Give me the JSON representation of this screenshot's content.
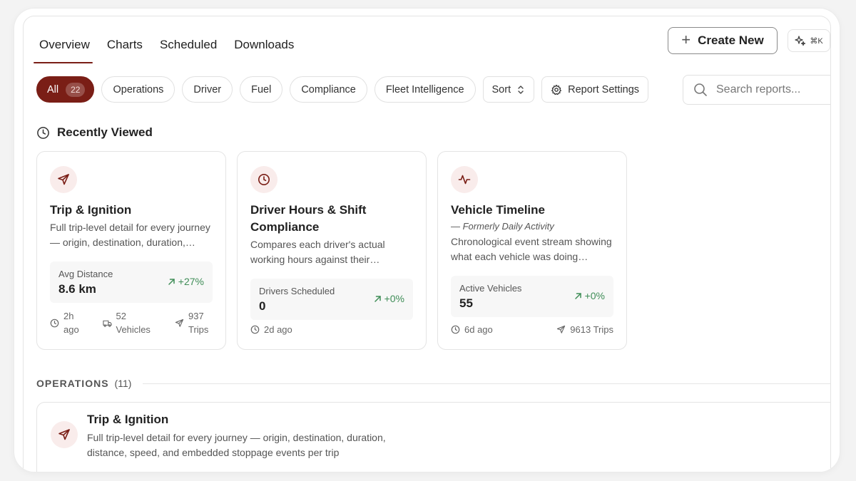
{
  "tabs": [
    {
      "label": "Overview",
      "active": true
    },
    {
      "label": "Charts"
    },
    {
      "label": "Scheduled"
    },
    {
      "label": "Downloads"
    }
  ],
  "header": {
    "create_label": "Create New",
    "shortcut_label": "⌘K"
  },
  "filters": {
    "all_label": "All",
    "all_count": "22",
    "chips": [
      "Operations",
      "Driver",
      "Fuel",
      "Compliance",
      "Fleet Intelligence"
    ],
    "sort_label": "Sort",
    "settings_label": "Report Settings"
  },
  "search": {
    "placeholder": "Search reports..."
  },
  "recent": {
    "title": "Recently Viewed",
    "cards": [
      {
        "icon": "send-icon",
        "title": "Trip & Ignition",
        "subtitle": "",
        "description": "Full trip-level detail for every journey — origin, destination, duration, distance, speed, and embedded stoppage events per trip",
        "metric_label": "Avg Distance",
        "metric_value": "8.6 km",
        "metric_delta": "+27%",
        "footer": {
          "time": "2h ago",
          "vehicles": "52 Vehicles",
          "trips": "937 Trips"
        }
      },
      {
        "icon": "clock-icon",
        "title": "Driver Hours & Shift Compliance",
        "subtitle": "",
        "description": "Compares each driver's actual working hours against their scheduled shifts",
        "metric_label": "Drivers Scheduled",
        "metric_value": "0",
        "metric_delta": "+0%",
        "footer": {
          "time": "2d ago"
        }
      },
      {
        "icon": "activity-icon",
        "title": "Vehicle Timeline",
        "subtitle": "— Formerly Daily Activity",
        "description": "Chronological event stream showing what each vehicle was doing throughout the day",
        "metric_label": "Active Vehicles",
        "metric_value": "55",
        "metric_delta": "+0%",
        "footer": {
          "time": "6d ago",
          "trips": "9613 Trips"
        }
      }
    ]
  },
  "operations": {
    "label": "OPERATIONS",
    "count": "(11)",
    "first_card": {
      "title": "Trip & Ignition",
      "description": "Full trip-level detail for every journey — origin, destination, duration, distance, speed, and embedded stoppage events per trip"
    }
  },
  "colors": {
    "accent": "#7a1e16",
    "positive": "#3f8d57",
    "icon_bg": "#f9eceb"
  }
}
